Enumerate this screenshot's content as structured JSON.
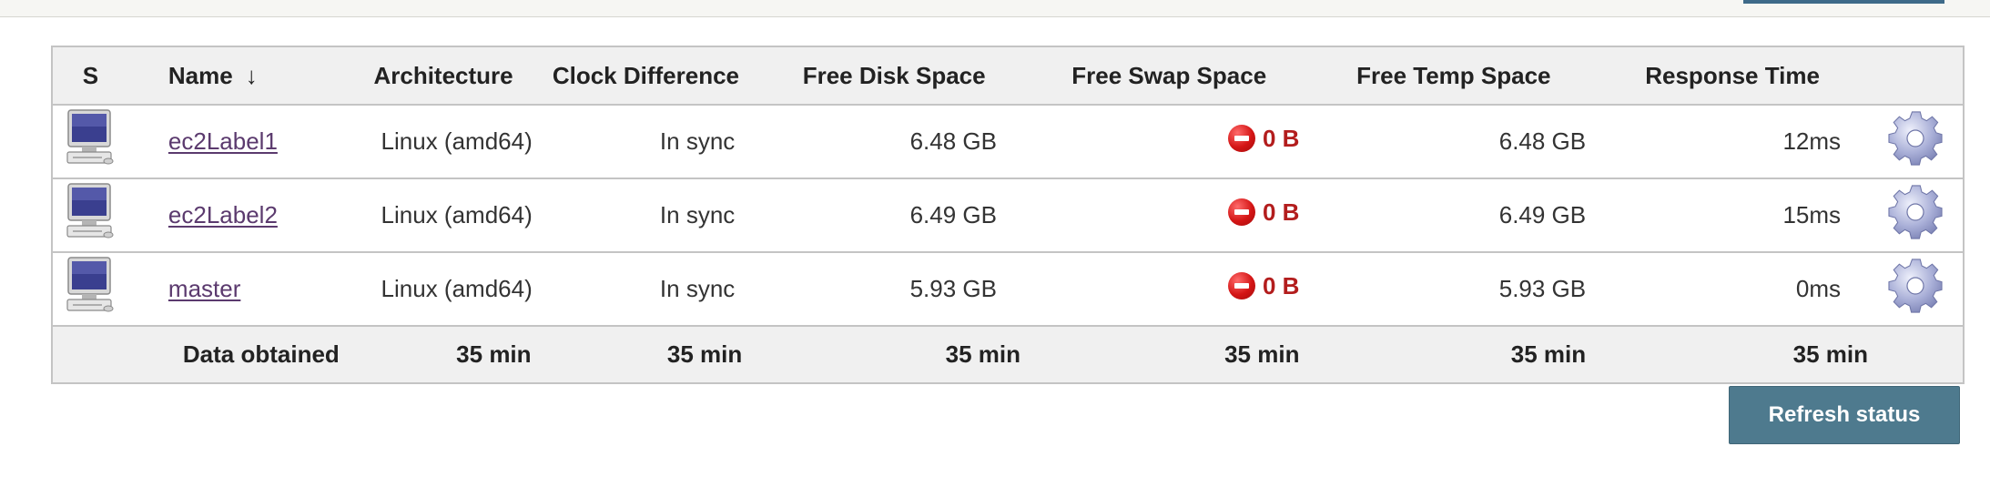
{
  "table": {
    "headers": {
      "status": "S",
      "name": "Name",
      "sort_indicator": "↓",
      "architecture": "Architecture",
      "clock_difference": "Clock Difference",
      "free_disk_space": "Free Disk Space",
      "free_swap_space": "Free Swap Space",
      "free_temp_space": "Free Temp Space",
      "response_time": "Response Time"
    },
    "rows": [
      {
        "icon": "computer-icon",
        "name": "ec2Label1",
        "architecture": "Linux (amd64)",
        "clock_difference": "In sync",
        "free_disk_space": "6.48 GB",
        "free_swap_space": "0 B",
        "free_temp_space": "6.48 GB",
        "response_time": "12ms",
        "action_icon": "gear-icon"
      },
      {
        "icon": "computer-icon",
        "name": "ec2Label2",
        "architecture": "Linux (amd64)",
        "clock_difference": "In sync",
        "free_disk_space": "6.49 GB",
        "free_swap_space": "0 B",
        "free_temp_space": "6.49 GB",
        "response_time": "15ms",
        "action_icon": "gear-icon"
      },
      {
        "icon": "computer-icon",
        "name": "master",
        "architecture": "Linux (amd64)",
        "clock_difference": "In sync",
        "free_disk_space": "5.93 GB",
        "free_swap_space": "0 B",
        "free_temp_space": "5.93 GB",
        "response_time": "0ms",
        "action_icon": "gear-icon"
      }
    ],
    "footer": {
      "label": "Data obtained",
      "architecture": "35 min",
      "clock_difference": "35 min",
      "free_disk_space": "35 min",
      "free_swap_space": "35 min",
      "free_temp_space": "35 min",
      "response_time": "35 min"
    }
  },
  "refresh_button_label": "Refresh status",
  "colors": {
    "swap_warning": "#b31d1d",
    "button": "#4e7a8e",
    "link": "#5b3a6e"
  }
}
